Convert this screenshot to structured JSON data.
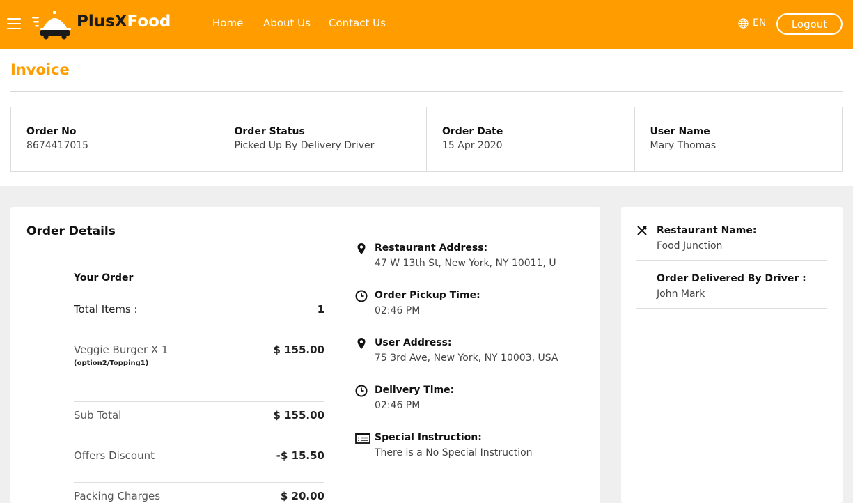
{
  "header": {
    "brand_part1": "PlusX",
    "brand_part2": "Food",
    "nav": {
      "home": "Home",
      "about": "About Us",
      "contact": "Contact Us"
    },
    "language": "EN",
    "logout": "Logout",
    "accent_color": "#ff9d00"
  },
  "page": {
    "title": "Invoice"
  },
  "summary": {
    "order_no_label": "Order No",
    "order_no": "8674417015",
    "status_label": "Order Status",
    "status": "Picked Up By Delivery Driver",
    "date_label": "Order Date",
    "date": "15 Apr 2020",
    "user_label": "User Name",
    "user": "Mary Thomas"
  },
  "order_details": {
    "title": "Order Details",
    "your_order": "Your Order",
    "total_items_label": "Total Items :",
    "total_items": "1",
    "item_name": "Veggie Burger X 1",
    "item_options": "(option2/Topping1)",
    "item_price": "$ 155.00",
    "subtotal_label": "Sub Total",
    "subtotal": "$ 155.00",
    "discount_label": "Offers Discount",
    "discount": "-$ 15.50",
    "packing_label": "Packing Charges",
    "packing": "$ 20.00"
  },
  "info": {
    "restaurant_address_label": "Restaurant Address:",
    "restaurant_address": "47 W 13th St, New York, NY 10011, U",
    "pickup_time_label": "Order Pickup Time:",
    "pickup_time": "02:46 PM",
    "user_address_label": "User Address:",
    "user_address": "75 3rd Ave, New York, NY 10003, USA",
    "delivery_time_label": "Delivery Time:",
    "delivery_time": "02:46 PM",
    "special_label": "Special Instruction:",
    "special": "There is a No Special Instruction"
  },
  "side": {
    "restaurant_label": "Restaurant Name:",
    "restaurant": "Food Junction",
    "driver_label": "Order Delivered By Driver :",
    "driver": "John Mark"
  }
}
